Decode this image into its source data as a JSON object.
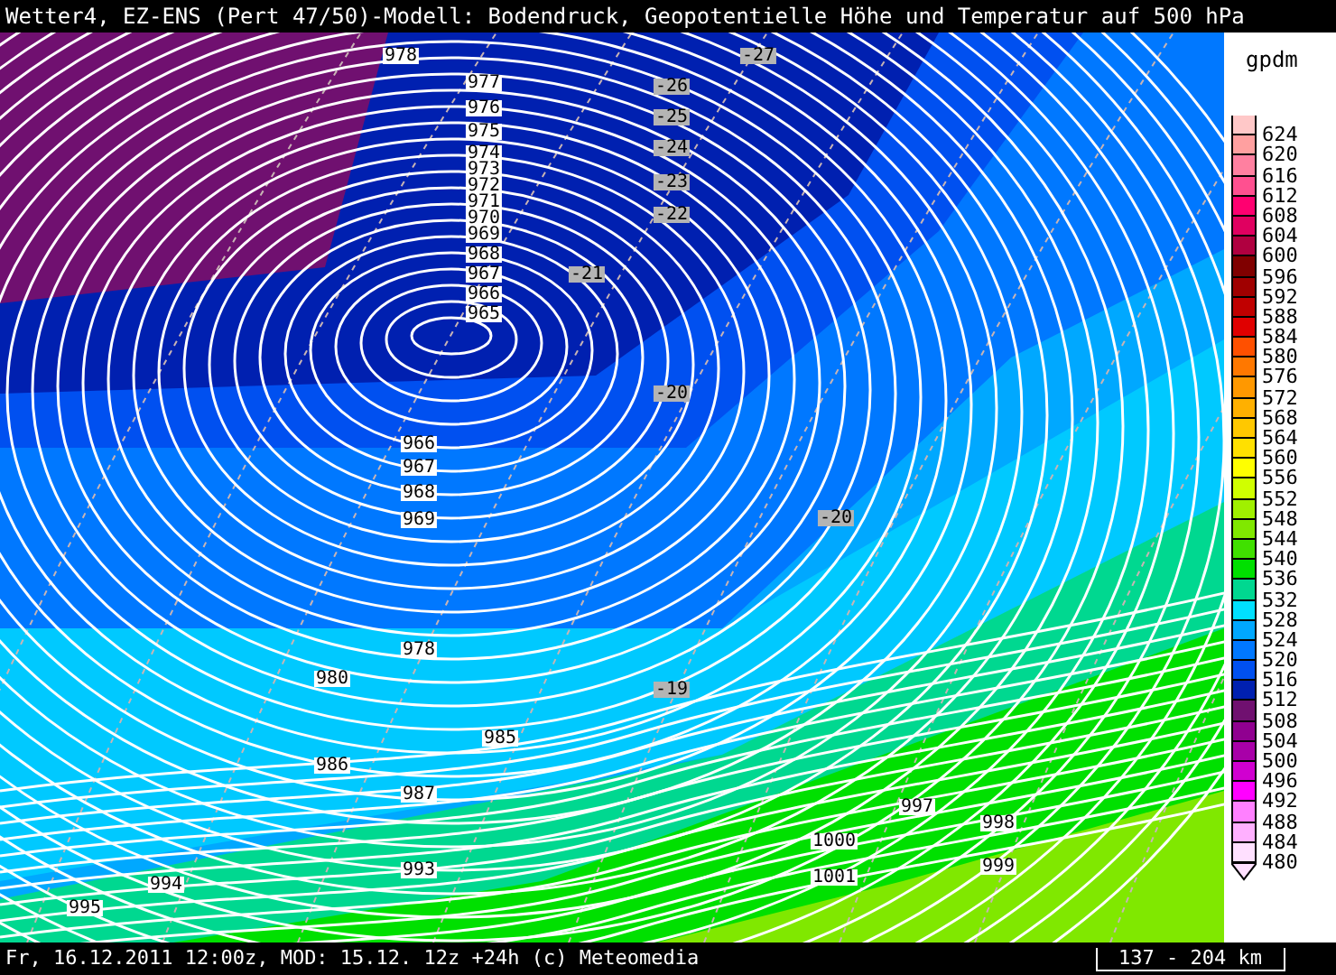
{
  "title": "Wetter4, EZ-ENS (Pert 47/50)-Modell: Bodendruck, Geopotentielle Höhe und Temperatur auf 500 hPa",
  "legend": {
    "unit": "gpdm",
    "items": [
      {
        "label": "624",
        "color": "#ffc8c8"
      },
      {
        "label": "620",
        "color": "#ffa0a0"
      },
      {
        "label": "616",
        "color": "#ff80a0"
      },
      {
        "label": "612",
        "color": "#ff5090"
      },
      {
        "label": "608",
        "color": "#ff0070"
      },
      {
        "label": "604",
        "color": "#e00060"
      },
      {
        "label": "600",
        "color": "#b00040"
      },
      {
        "label": "596",
        "color": "#800000"
      },
      {
        "label": "592",
        "color": "#a00000"
      },
      {
        "label": "588",
        "color": "#c00000"
      },
      {
        "label": "584",
        "color": "#e00000"
      },
      {
        "label": "580",
        "color": "#ff5000"
      },
      {
        "label": "576",
        "color": "#ff7800"
      },
      {
        "label": "572",
        "color": "#ff9800"
      },
      {
        "label": "568",
        "color": "#ffb000"
      },
      {
        "label": "564",
        "color": "#ffc800"
      },
      {
        "label": "560",
        "color": "#ffe000"
      },
      {
        "label": "556",
        "color": "#ffff00"
      },
      {
        "label": "552",
        "color": "#d0ff00"
      },
      {
        "label": "548",
        "color": "#a0f000"
      },
      {
        "label": "544",
        "color": "#80e800"
      },
      {
        "label": "540",
        "color": "#40e000"
      },
      {
        "label": "536",
        "color": "#00e000"
      },
      {
        "label": "532",
        "color": "#00d890"
      },
      {
        "label": "528",
        "color": "#00e0ff"
      },
      {
        "label": "524",
        "color": "#00a8ff"
      },
      {
        "label": "520",
        "color": "#0078ff"
      },
      {
        "label": "516",
        "color": "#0050f0"
      },
      {
        "label": "512",
        "color": "#0020b0"
      },
      {
        "label": "508",
        "color": "#701070"
      },
      {
        "label": "504",
        "color": "#900090"
      },
      {
        "label": "500",
        "color": "#a800a8"
      },
      {
        "label": "496",
        "color": "#d000d0"
      },
      {
        "label": "492",
        "color": "#ff00ff"
      },
      {
        "label": "488",
        "color": "#ff80ff"
      },
      {
        "label": "484",
        "color": "#ffb0ff"
      },
      {
        "label": "480",
        "color": "#ffe0ff"
      }
    ]
  },
  "map_labels": [
    {
      "kind": "pressure",
      "text": "978"
    },
    {
      "kind": "pressure",
      "text": "977"
    },
    {
      "kind": "pressure",
      "text": "976"
    },
    {
      "kind": "pressure",
      "text": "975"
    },
    {
      "kind": "pressure",
      "text": "974"
    },
    {
      "kind": "pressure",
      "text": "973"
    },
    {
      "kind": "pressure",
      "text": "972"
    },
    {
      "kind": "pressure",
      "text": "971"
    },
    {
      "kind": "pressure",
      "text": "970"
    },
    {
      "kind": "pressure",
      "text": "969"
    },
    {
      "kind": "pressure",
      "text": "968"
    },
    {
      "kind": "pressure",
      "text": "967"
    },
    {
      "kind": "pressure",
      "text": "966"
    },
    {
      "kind": "pressure",
      "text": "965"
    },
    {
      "kind": "temperature",
      "text": "-27"
    },
    {
      "kind": "temperature",
      "text": "-26"
    },
    {
      "kind": "temperature",
      "text": "-25"
    },
    {
      "kind": "temperature",
      "text": "-24"
    },
    {
      "kind": "temperature",
      "text": "-23"
    },
    {
      "kind": "temperature",
      "text": "-22"
    },
    {
      "kind": "temperature",
      "text": "-21"
    },
    {
      "kind": "temperature",
      "text": "-20"
    },
    {
      "kind": "temperature",
      "text": "-20"
    },
    {
      "kind": "temperature",
      "text": "-19"
    },
    {
      "kind": "pressure",
      "text": "966"
    },
    {
      "kind": "pressure",
      "text": "967"
    },
    {
      "kind": "pressure",
      "text": "968"
    },
    {
      "kind": "pressure",
      "text": "969"
    },
    {
      "kind": "pressure",
      "text": "978"
    },
    {
      "kind": "pressure",
      "text": "980"
    },
    {
      "kind": "pressure",
      "text": "985"
    },
    {
      "kind": "pressure",
      "text": "986"
    },
    {
      "kind": "pressure",
      "text": "987"
    },
    {
      "kind": "pressure",
      "text": "993"
    },
    {
      "kind": "pressure",
      "text": "994"
    },
    {
      "kind": "pressure",
      "text": "995"
    },
    {
      "kind": "pressure",
      "text": "997"
    },
    {
      "kind": "pressure",
      "text": "998"
    },
    {
      "kind": "pressure",
      "text": "999"
    },
    {
      "kind": "pressure",
      "text": "1000"
    },
    {
      "kind": "pressure",
      "text": "1001"
    }
  ],
  "footer": "Fr, 16.12.2011 12:00z, MOD: 15.12. 12z +24h (c) Meteomedia",
  "scale": "137 - 204 km"
}
